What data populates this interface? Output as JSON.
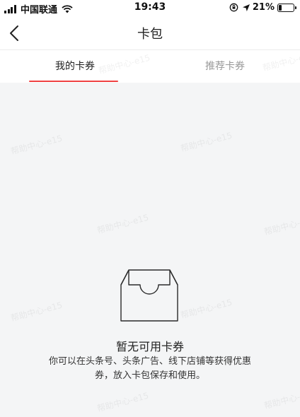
{
  "status_bar": {
    "carrier": "中国联通",
    "time": "19:43",
    "battery": "21%",
    "battery_level": 0.21
  },
  "nav": {
    "title": "卡包"
  },
  "tabs": [
    {
      "label": "我的卡券",
      "active": true
    },
    {
      "label": "推荐卡券",
      "active": false
    }
  ],
  "empty_state": {
    "title": "暂无可用卡券",
    "description": "你可以在头条号、头条广告、线下店铺等获得优惠券，放入卡包保存和使用。"
  },
  "watermark": "帮助中心-e15",
  "colors": {
    "accent": "#f04142",
    "background": "#f4f5f6"
  }
}
